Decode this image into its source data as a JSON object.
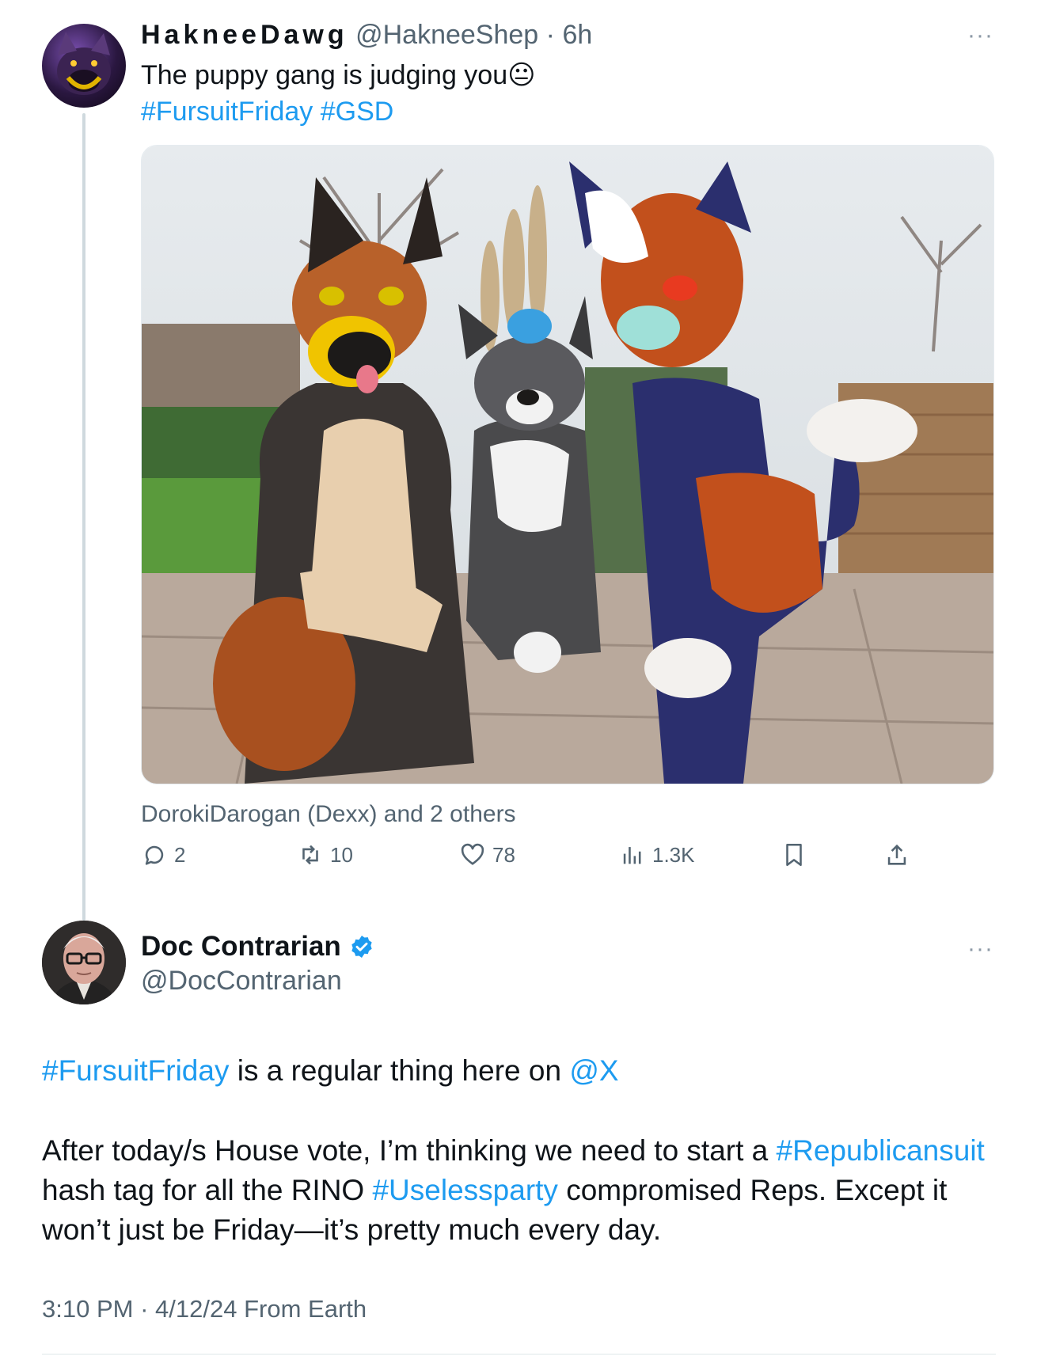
{
  "thread_tweet": {
    "display_name": "HakneeDawg",
    "handle": "@HakneeShep",
    "separator": "·",
    "time": "6h",
    "text": "The puppy gang is judging you",
    "emoji": "😐",
    "hashtags": [
      "#FursuitFriday",
      "#GSD"
    ],
    "tagged": "DorokiDarogan (Dexx) and 2 others",
    "more_label": "···",
    "actions": {
      "replies": "2",
      "reposts": "10",
      "likes": "78",
      "views": "1.3K"
    }
  },
  "main_tweet": {
    "display_name": "Doc Contrarian",
    "verified": true,
    "handle": "@DocContrarian",
    "more_label": "···",
    "line1": {
      "hashtag": "#FursuitFriday",
      "text": " is a regular thing here on ",
      "mention": "@X"
    },
    "para2": {
      "t1": "After today/s House vote, I’m thinking we need to start a ",
      "hashtag1": "#Republicansuit",
      "t2": " hash tag for all the RINO ",
      "hashtag2": "#Uselessparty",
      "t3": " compromised Reps. Except it won’t just be Friday—it’s pretty much every day."
    },
    "footer": {
      "time": "3:10 PM",
      "separator": "·",
      "date": "4/12/24",
      "source": "From Earth"
    }
  },
  "colors": {
    "link": "#1d9bf0",
    "muted": "#536471",
    "verified": "#1d9bf0"
  }
}
